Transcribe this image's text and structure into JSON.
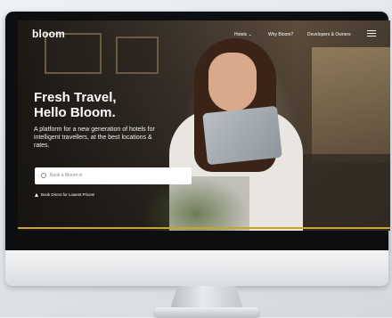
{
  "brand": {
    "logo_text": "bloom",
    "accent_color": "#c9a227"
  },
  "nav": {
    "items": [
      {
        "label": "Hotels ⌄"
      },
      {
        "label": "Why Bloom?"
      },
      {
        "label": "Developers & Owners"
      }
    ],
    "menu_icon": "hamburger-icon"
  },
  "hero": {
    "headline_line1": "Fresh Travel,",
    "headline_line2": "Hello Bloom.",
    "subtext": "A platform for a new generation of hotels for intelligent travellers, at the best locations & rates."
  },
  "search": {
    "icon": "search-icon",
    "placeholder": "Book a Bloom in"
  },
  "direct_booking": {
    "icon": "tag-icon",
    "label": "Book Direct for Lowest Prices!"
  }
}
